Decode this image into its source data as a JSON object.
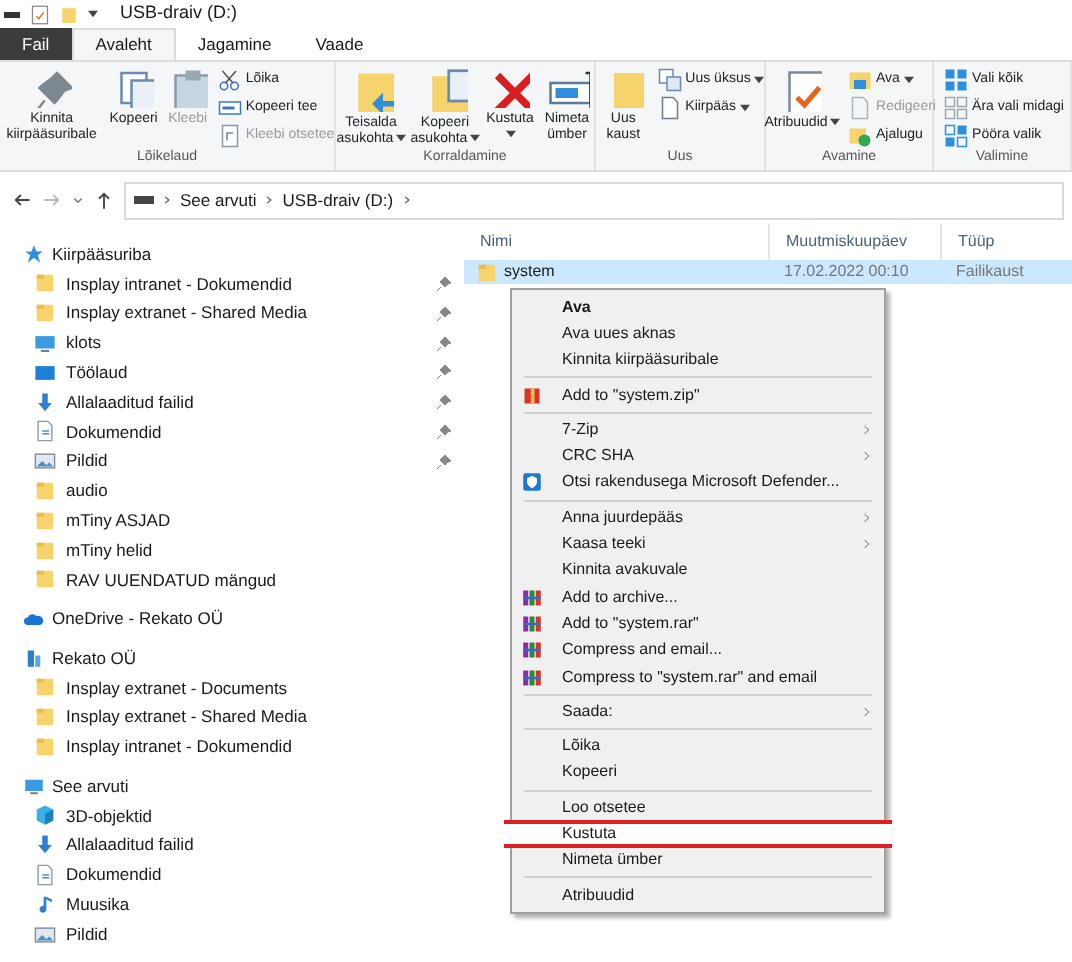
{
  "window": {
    "title": "USB-draiv (D:)"
  },
  "tabs": [
    {
      "label": "Fail",
      "kind": "file",
      "selected": false
    },
    {
      "label": "Avaleht",
      "kind": "tab",
      "selected": true
    },
    {
      "label": "Jagamine",
      "kind": "tab",
      "selected": false
    },
    {
      "label": "Vaade",
      "kind": "tab",
      "selected": false
    }
  ],
  "ribbon": {
    "groups": [
      {
        "label": "Lõikelaud",
        "large": [
          {
            "label": "Kinnita kiirpääsuribale",
            "disabled": false,
            "dropdown": false
          },
          {
            "label": "Kopeeri",
            "disabled": false,
            "dropdown": false
          },
          {
            "label": "Kleebi",
            "disabled": true,
            "dropdown": false
          }
        ],
        "small": [
          {
            "label": "Lõika",
            "disabled": false,
            "dropdown": false
          },
          {
            "label": "Kopeeri tee",
            "disabled": false,
            "dropdown": false
          },
          {
            "label": "Kleebi otsetee",
            "disabled": true,
            "dropdown": false
          }
        ]
      },
      {
        "label": "Korraldamine",
        "large": [
          {
            "label": "Teisalda asukohta",
            "disabled": false,
            "dropdown": true
          },
          {
            "label": "Kopeeri asukohta",
            "disabled": false,
            "dropdown": true
          },
          {
            "label": "Kustuta",
            "disabled": false,
            "dropdown": true
          },
          {
            "label": "Nimeta ümber",
            "disabled": false,
            "dropdown": false
          }
        ]
      },
      {
        "label": "Uus",
        "large": [
          {
            "label": "Uus kaust",
            "disabled": false,
            "dropdown": false
          }
        ],
        "small": [
          {
            "label": "Uus üksus",
            "disabled": false,
            "dropdown": true
          },
          {
            "label": "Kiirpääs",
            "disabled": false,
            "dropdown": true
          }
        ]
      },
      {
        "label": "Avamine",
        "large": [
          {
            "label": "Atribuudid",
            "disabled": false,
            "dropdown": true
          }
        ],
        "small": [
          {
            "label": "Ava",
            "disabled": false,
            "dropdown": true
          },
          {
            "label": "Redigeeri",
            "disabled": true,
            "dropdown": false
          },
          {
            "label": "Ajalugu",
            "disabled": false,
            "dropdown": false
          }
        ]
      },
      {
        "label": "Valimine",
        "small": [
          {
            "label": "Vali kõik",
            "disabled": false,
            "dropdown": false
          },
          {
            "label": "Ära vali midagi",
            "disabled": false,
            "dropdown": false
          },
          {
            "label": "Pööra valik",
            "disabled": false,
            "dropdown": false
          }
        ]
      }
    ]
  },
  "address": {
    "crumbs": [
      "See arvuti",
      "USB-draiv (D:)"
    ]
  },
  "sidebar": {
    "sections": [
      {
        "label": "Kiirpääsuriba",
        "kind": "star",
        "children": [
          {
            "label": "Insplay intranet - Dokumendid",
            "kind": "folder",
            "pinned": true
          },
          {
            "label": "Insplay extranet - Shared Media",
            "kind": "folder",
            "pinned": true
          },
          {
            "label": "klots",
            "kind": "monitor",
            "pinned": true
          },
          {
            "label": "Töölaud",
            "kind": "desktop",
            "pinned": true
          },
          {
            "label": "Allalaaditud failid",
            "kind": "download",
            "pinned": true
          },
          {
            "label": "Dokumendid",
            "kind": "document",
            "pinned": true
          },
          {
            "label": "Pildid",
            "kind": "image",
            "pinned": true
          },
          {
            "label": "audio",
            "kind": "folder",
            "pinned": false
          },
          {
            "label": "mTiny ASJAD",
            "kind": "folder",
            "pinned": false
          },
          {
            "label": "mTiny helid",
            "kind": "folder",
            "pinned": false
          },
          {
            "label": "RAV UUENDATUD mängud",
            "kind": "folder",
            "pinned": false
          }
        ]
      },
      {
        "label": "OneDrive - Rekato OÜ",
        "kind": "cloud"
      },
      {
        "label": "Rekato OÜ",
        "kind": "building",
        "children": [
          {
            "label": "Insplay extranet - Documents",
            "kind": "folder",
            "pinned": false
          },
          {
            "label": "Insplay extranet - Shared Media",
            "kind": "folder",
            "pinned": false
          },
          {
            "label": "Insplay intranet - Dokumendid",
            "kind": "folder",
            "pinned": false
          }
        ]
      },
      {
        "label": "See arvuti",
        "kind": "monitor",
        "children": [
          {
            "label": "3D-objektid",
            "kind": "cube",
            "pinned": false
          },
          {
            "label": "Allalaaditud failid",
            "kind": "download",
            "pinned": false
          },
          {
            "label": "Dokumendid",
            "kind": "document",
            "pinned": false
          },
          {
            "label": "Muusika",
            "kind": "music",
            "pinned": false
          },
          {
            "label": "Pildid",
            "kind": "image",
            "pinned": false
          }
        ]
      }
    ]
  },
  "table": {
    "columns": [
      "Nimi",
      "Muutmiskuupäev",
      "Tüüp"
    ],
    "rows": [
      {
        "cells": [
          "system",
          "17.02.2022 00:10",
          "Failikaust"
        ],
        "selected": true
      }
    ]
  },
  "context_menu": {
    "items": [
      {
        "kind": "default",
        "label": "Ava",
        "submenu": false,
        "marked": false
      },
      {
        "kind": "item",
        "label": "Ava uues aknas",
        "submenu": false,
        "marked": false
      },
      {
        "kind": "item",
        "label": "Kinnita kiirpääsuribale",
        "submenu": false,
        "marked": false
      },
      {
        "kind": "separator"
      },
      {
        "kind": "zip",
        "label": "Add to \"system.zip\"",
        "submenu": false,
        "marked": false
      },
      {
        "kind": "separator"
      },
      {
        "kind": "item",
        "label": "7-Zip",
        "submenu": true,
        "marked": false
      },
      {
        "kind": "item",
        "label": "CRC SHA",
        "submenu": true,
        "marked": false
      },
      {
        "kind": "defender",
        "label": "Otsi rakendusega Microsoft Defender...",
        "submenu": false,
        "marked": false
      },
      {
        "kind": "separator"
      },
      {
        "kind": "item",
        "label": "Anna juurdepääs",
        "submenu": true,
        "marked": false
      },
      {
        "kind": "item",
        "label": "Kaasa teeki",
        "submenu": true,
        "marked": false
      },
      {
        "kind": "item",
        "label": "Kinnita avakuvale",
        "submenu": false,
        "marked": false
      },
      {
        "kind": "rar",
        "label": "Add to archive...",
        "submenu": false,
        "marked": false
      },
      {
        "kind": "rar",
        "label": "Add to \"system.rar\"",
        "submenu": false,
        "marked": false
      },
      {
        "kind": "rar",
        "label": "Compress and email...",
        "submenu": false,
        "marked": false
      },
      {
        "kind": "rar",
        "label": "Compress to \"system.rar\" and email",
        "submenu": false,
        "marked": false
      },
      {
        "kind": "separator"
      },
      {
        "kind": "item",
        "label": "Saada:",
        "submenu": true,
        "marked": false
      },
      {
        "kind": "separator"
      },
      {
        "kind": "item",
        "label": "Lõika",
        "submenu": false,
        "marked": false
      },
      {
        "kind": "item",
        "label": "Kopeeri",
        "submenu": false,
        "marked": false
      },
      {
        "kind": "separator"
      },
      {
        "kind": "item",
        "label": "Loo otsetee",
        "submenu": false,
        "marked": false
      },
      {
        "kind": "item",
        "label": "Kustuta",
        "submenu": false,
        "marked": true
      },
      {
        "kind": "item",
        "label": "Nimeta ümber",
        "submenu": false,
        "marked": false
      },
      {
        "kind": "separator"
      },
      {
        "kind": "item",
        "label": "Atribuudid",
        "submenu": false,
        "marked": false
      }
    ]
  }
}
